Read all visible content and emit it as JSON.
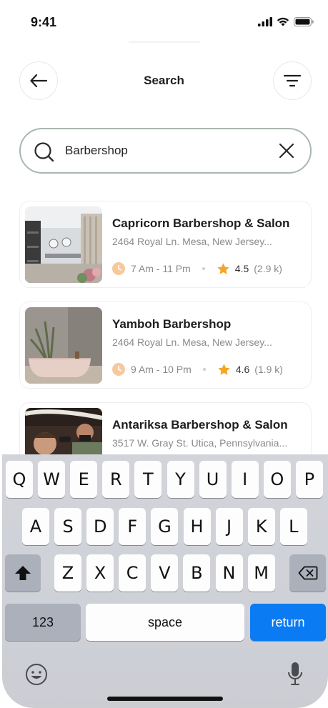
{
  "status_bar": {
    "time": "9:41"
  },
  "header": {
    "title": "Search"
  },
  "search": {
    "value": "Barbershop",
    "placeholder": "Search"
  },
  "results": [
    {
      "name": "Capricorn Barbershop & Salon",
      "address": "2464 Royal Ln. Mesa, New Jersey...",
      "hours": "7 Am - 11 Pm",
      "rating": "4.5",
      "reviews": "(2.9 k)"
    },
    {
      "name": "Yamboh Barbershop",
      "address": "2464 Royal Ln. Mesa, New Jersey...",
      "hours": "9 Am - 10 Pm",
      "rating": "4.6",
      "reviews": "(1.9 k)"
    },
    {
      "name": "Antariksa Barbershop & Salon",
      "address": "3517 W. Gray St. Utica, Pennsylvania...",
      "hours": "",
      "rating": "",
      "reviews": ""
    }
  ],
  "keyboard": {
    "row1": [
      "Q",
      "W",
      "E",
      "R",
      "T",
      "Y",
      "U",
      "I",
      "O",
      "P"
    ],
    "row2": [
      "A",
      "S",
      "D",
      "F",
      "G",
      "H",
      "J",
      "K",
      "L"
    ],
    "row3": [
      "Z",
      "X",
      "C",
      "V",
      "B",
      "N",
      "M"
    ],
    "numbers_label": "123",
    "space_label": "space",
    "return_label": "return"
  },
  "colors": {
    "accent": "#a8b8ad",
    "clock": "#f6c99c",
    "star": "#f5a623",
    "return_key": "#0a7bf2"
  },
  "icons": [
    "signal-icon",
    "wifi-icon",
    "battery-icon",
    "back-arrow-icon",
    "filter-icon",
    "search-icon",
    "close-icon",
    "clock-icon",
    "star-icon",
    "shift-icon",
    "backspace-icon",
    "emoji-icon",
    "microphone-icon"
  ]
}
